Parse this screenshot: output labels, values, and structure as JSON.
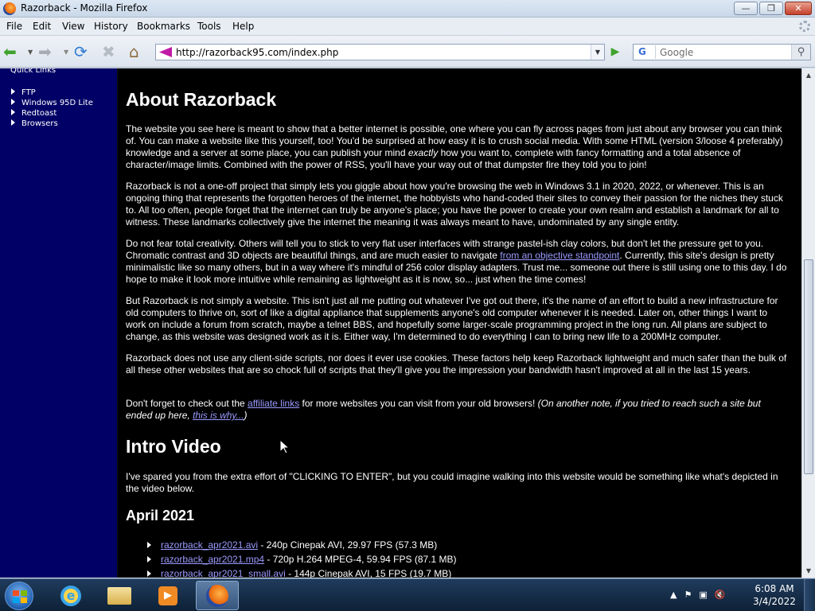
{
  "window": {
    "title": "Razorback - Mozilla Firefox",
    "buttons": {
      "minimize": "—",
      "maximize": "❐",
      "close": "✕"
    }
  },
  "menu": [
    "File",
    "Edit",
    "View",
    "History",
    "Bookmarks",
    "Tools",
    "Help"
  ],
  "toolbar": {
    "url": "http://razorback95.com/index.php",
    "search_placeholder": "Google",
    "search_engine_glyph": "G"
  },
  "sidebar": {
    "heading": "Quick Links",
    "items": [
      "FTP",
      "Windows 95D Lite",
      "Redtoast",
      "Browsers"
    ]
  },
  "content": {
    "about_heading": "About Razorback",
    "p1": "The website you see here is meant to show that a better internet is possible, one where you can fly across pages from just about any browser you can think of. You can make a website like this yourself, too! You'd be surprised at how easy it is to crush social media. With some HTML (version 3/loose 4 preferably) knowledge and a server at some place, you can publish your mind ",
    "p1_em": "exactly",
    "p1_tail": " how you want to, complete with fancy formatting and a total absence of character/image limits. Combined with the power of RSS, you'll have your way out of that dumpster fire they told you to join!",
    "p2": "Razorback is not a one-off project that simply lets you giggle about how you're browsing the web in Windows 3.1 in 2020, 2022, or whenever. This is an ongoing thing that represents the forgotten heroes of the internet, the hobbyists who hand-coded their sites to convey their passion for the niches they stuck to. All too often, people forget that the internet can truly be anyone's place; you have the power to create your own realm and establish a landmark for all to witness. These landmarks collectively give the internet the meaning it was always meant to have, undominated by any single entity.",
    "p3_a": "Do not fear total creativity. Others will tell you to stick to very flat user interfaces with strange pastel-ish clay colors, but don't let the pressure get to you. Chromatic contrast and 3D objects are beautiful things, and are much easier to navigate ",
    "p3_link": "from an objective standpoint",
    "p3_b": ". Currently, this site's design is pretty minimalistic like so many others, but in a way where it's mindful of 256 color display adapters. Trust me... someone out there is still using one to this day. I do hope to make it look more intuitive while remaining as lightweight as it is now, so... just when the time comes!",
    "p4": "But Razorback is not simply a website. This isn't just all me putting out whatever I've got out there, it's the name of an effort to build a new infrastructure for old computers to thrive on, sort of like a digital appliance that supplements anyone's old computer whenever it is needed. Later on, other things I want to work on include a forum from scratch, maybe a telnet BBS, and hopefully some larger-scale programming project in the long run. All plans are subject to change, as this website was designed work as it is. Either way, I'm determined to do everything I can to bring new life to a 200MHz computer.",
    "p5": "Razorback does not use any client-side scripts, nor does it ever use cookies. These factors help keep Razorback lightweight and much safer than the bulk of all these other websites that are so chock full of scripts that they'll give you the impression your bandwidth hasn't improved at all in the last 15 years.",
    "p6_a": "Don't forget to check out the ",
    "p6_link": "affiliate links",
    "p6_b": " for more websites you can visit from your old browsers! ",
    "p6_em_a": "(On another note, if you tried to reach such a site but ended up here, ",
    "p6_em_link": "this is why...",
    "p6_em_b": ")",
    "video_heading": "Intro Video",
    "video_text": "I've spared you from the extra effort of \"CLICKING TO ENTER\", but you could imagine walking into this website would be something like what's depicted in the video below.",
    "april_heading": "April 2021",
    "videos": [
      {
        "link": "razorback_apr2021.avi",
        "desc": " - 240p Cinepak AVI, 29.97 FPS (57.3 MB)"
      },
      {
        "link": "razorback_apr2021.mp4",
        "desc": " - 720p H.264 MPEG-4, 59.94 FPS (87.1 MB)"
      },
      {
        "link": "razorback_apr2021_small.avi",
        "desc": " - 144p Cinepak AVI, 15 FPS (19.7 MB)"
      }
    ]
  },
  "taskbar": {
    "clock_time": "6:08 AM",
    "clock_date": "3/4/2022",
    "apps": [
      "internet-explorer",
      "windows-explorer",
      "windows-media-player",
      "firefox"
    ]
  }
}
